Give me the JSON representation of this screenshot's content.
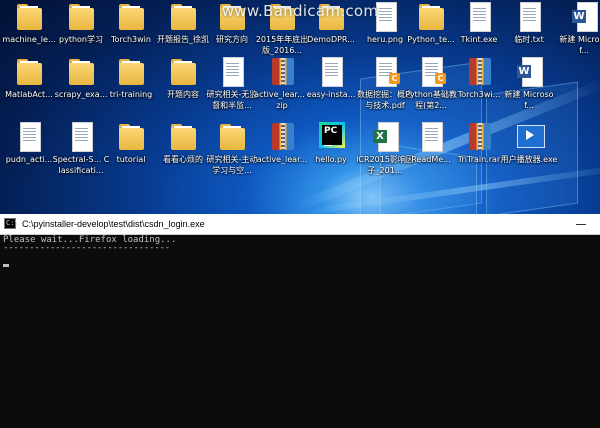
{
  "watermark": "www.Bandicam.com",
  "desktop_icons": [
    {
      "label": "machine_le...",
      "type": "folder"
    },
    {
      "label": "python学习",
      "type": "folder"
    },
    {
      "label": "Torch3win",
      "type": "folder"
    },
    {
      "label": "开题报告_徐凯",
      "type": "folder"
    },
    {
      "label": "研究方向",
      "type": "folder"
    },
    {
      "label": "2015年年底出版_2016...",
      "type": "folder"
    },
    {
      "label": "DemoDPR...",
      "type": "folder"
    },
    {
      "label": "heru.png",
      "type": "doc"
    },
    {
      "label": "Python_te...",
      "type": "folder"
    },
    {
      "label": "Tkint.exe",
      "type": "doc"
    },
    {
      "label": "临时.txt",
      "type": "doc"
    },
    {
      "label": "新建 Microsof...",
      "type": "word"
    },
    {
      "label": "MatlabAct...",
      "type": "folder"
    },
    {
      "label": "scrapy_exa...",
      "type": "folder"
    },
    {
      "label": "tri-training",
      "type": "folder"
    },
    {
      "label": "开题内容",
      "type": "folder"
    },
    {
      "label": "研究相关-无监督和半监...",
      "type": "doc"
    },
    {
      "label": "active_lear... .zip",
      "type": "zip"
    },
    {
      "label": "easy-insta...",
      "type": "doc"
    },
    {
      "label": "数据挖掘：概念与技术.pdf",
      "type": "pdf"
    },
    {
      "label": "Python基础教程(第2...",
      "type": "pdf"
    },
    {
      "label": "Torch3wi...",
      "type": "zip"
    },
    {
      "label": "新建 Microsof...",
      "type": "word"
    },
    {
      "label": "pudn_acti...",
      "type": "doc"
    },
    {
      "label": "Spectral-S... Classificati...",
      "type": "doc"
    },
    {
      "label": "tutorial",
      "type": "folder"
    },
    {
      "label": "看看心烦的",
      "type": "folder"
    },
    {
      "label": "研究相关-主动学习与空...",
      "type": "folder"
    },
    {
      "label": "active_lear...",
      "type": "zip"
    },
    {
      "label": "hello.py",
      "type": "pycharm"
    },
    {
      "label": "ICR2015影响因子_201...",
      "type": "excel"
    },
    {
      "label": "ReadMe...",
      "type": "doc"
    },
    {
      "label": "TriTrain.rar",
      "type": "zip"
    },
    {
      "label": "用户播放器.exe",
      "type": "exe"
    }
  ],
  "window": {
    "title": "C:\\pyinstaller-develop\\test\\dist\\csdn_login.exe",
    "console_lines": [
      "Please wait...Firefox loading...",
      "--------------------------------"
    ]
  },
  "colors": {
    "console_bg": "#0c0c0c",
    "console_text": "#c0c0c0",
    "titlebar_bg": "#ffffff"
  }
}
